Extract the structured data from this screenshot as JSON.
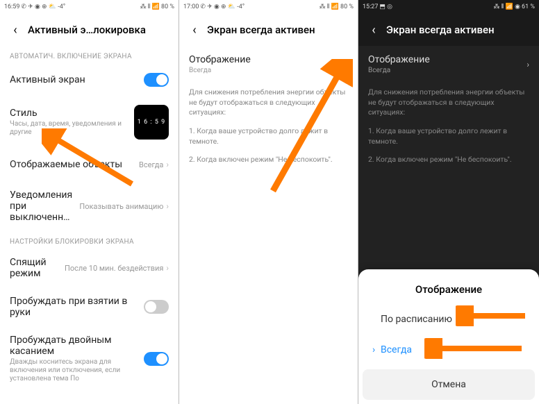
{
  "s1": {
    "status": {
      "time": "16:59",
      "icons_l": "✆ ✈ ◉ ⊕ ⛅ -4°",
      "icons_r": "⁂ ⫴ 📶",
      "batt": "80 %"
    },
    "title": "Активный э…локировка",
    "section_auto": "АВТОМАТИЧ. ВКЛЮЧЕНИЕ ЭКРАНА",
    "active_screen": "Активный экран",
    "style": {
      "label": "Стиль",
      "sub": "Часы, дата, время, уведомления и другие",
      "time": "1 6 : 5 9"
    },
    "objects": {
      "label": "Отображаемые объекты",
      "val": "Всегда"
    },
    "notif": {
      "label": "Уведомления при выключенн…",
      "val": "Показывать анимацию"
    },
    "section_lock": "НАСТРОЙКИ БЛОКИРОВКИ ЭКРАНА",
    "sleep": {
      "label": "Спящий режим",
      "val": "После 10 мин. бездействия"
    },
    "raise": "Пробуждать при взятии в руки",
    "doubletap": {
      "label": "Пробуждать двойным касанием",
      "sub": "Дважды коснитесь экрана для включения или отключения, если установлена тема По"
    }
  },
  "s2": {
    "status": {
      "time": "17:00",
      "icons_l": "✆ ✈ ◉ ⊕ ⛅ -4°",
      "icons_r": "⁂ ⫴ 📶",
      "batt": "80 %"
    },
    "title": "Экран всегда активен",
    "display": {
      "label": "Отображение",
      "val": "Всегда"
    },
    "note": "Для снижения потребления энергии объекты не будут отображаться в следующих ситуациях:",
    "note1": "1. Когда ваше устройство долго лежит в темноте.",
    "note2": "2. Когда включен режим \"Не беспокоить\"."
  },
  "s3": {
    "status": {
      "time": "15:27",
      "icons_l": "⬒ ◎",
      "icons_r": "⁂ ⫴ 📶 ◉",
      "batt": "61 %"
    },
    "title": "Экран всегда активен",
    "display": {
      "label": "Отображение",
      "val": "Всегда"
    },
    "note": "Для снижения потребления энергии объекты не будут отображаться в следующих ситуациях:",
    "note1": "1. Когда ваше устройство долго лежит в темноте.",
    "note2": "2. Когда включен режим \"Не беспокоить\".",
    "sheet": {
      "title": "Отображение",
      "opt1": "По расписанию",
      "opt2": "Всегда",
      "cancel": "Отмена"
    }
  }
}
